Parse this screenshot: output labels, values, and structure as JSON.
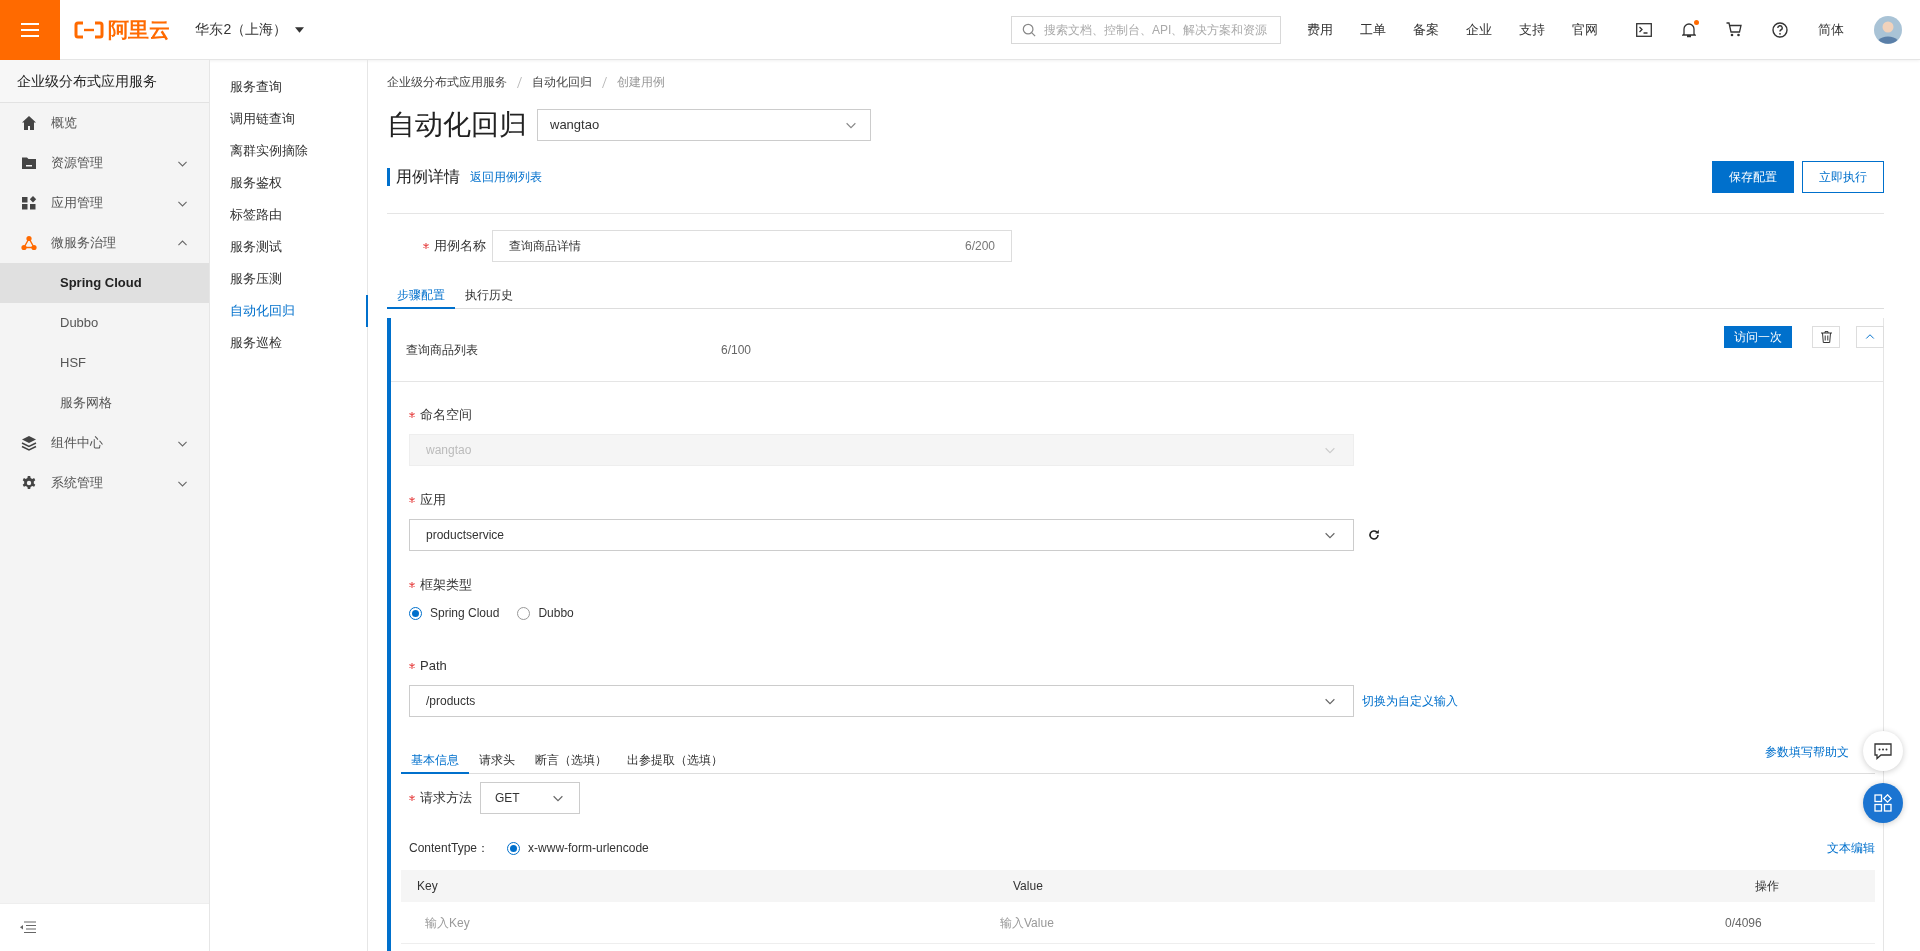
{
  "topbar": {
    "logo": "阿里云",
    "region": "华东2（上海）",
    "search_placeholder": "搜索文档、控制台、API、解决方案和资源",
    "links": [
      "费用",
      "工单",
      "备案",
      "企业",
      "支持",
      "官网"
    ],
    "notification_dot": true,
    "language": "简体"
  },
  "sidebar": {
    "title": "企业级分布式应用服务",
    "items": [
      {
        "label": "概览"
      },
      {
        "label": "资源管理",
        "expanded": false
      },
      {
        "label": "应用管理",
        "expanded": false
      },
      {
        "label": "微服务治理",
        "expanded": true,
        "children": [
          {
            "label": "Spring Cloud",
            "selected": true
          },
          {
            "label": "Dubbo",
            "selected": false
          },
          {
            "label": "HSF",
            "selected": false
          },
          {
            "label": "服务网格",
            "selected": false
          }
        ]
      },
      {
        "label": "组件中心",
        "expanded": false
      },
      {
        "label": "系统管理",
        "expanded": false
      }
    ]
  },
  "subnav": [
    {
      "label": "服务查询",
      "selected": false
    },
    {
      "label": "调用链查询",
      "selected": false
    },
    {
      "label": "离群实例摘除",
      "selected": false
    },
    {
      "label": "服务鉴权",
      "selected": false
    },
    {
      "label": "标签路由",
      "selected": false
    },
    {
      "label": "服务测试",
      "selected": false
    },
    {
      "label": "服务压测",
      "selected": false
    },
    {
      "label": "自动化回归",
      "selected": true
    },
    {
      "label": "服务巡检",
      "selected": false
    }
  ],
  "breadcrumb": [
    "企业级分布式应用服务",
    "自动化回归",
    "创建用例"
  ],
  "page": {
    "title": "自动化回归",
    "namespace": "wangtao"
  },
  "section": {
    "title": "用例详情",
    "back_link": "返回用例列表",
    "buttons": [
      {
        "label": "保存配置",
        "kind": "primary"
      },
      {
        "label": "立即执行",
        "kind": "secondary"
      }
    ]
  },
  "case_name": {
    "label": "用例名称",
    "required": true,
    "value": "查询商品详情",
    "counter": "6/200"
  },
  "tabs": [
    {
      "label": "步骤配置",
      "selected": true
    },
    {
      "label": "执行历史",
      "selected": false
    }
  ],
  "step": {
    "name": "查询商品列表",
    "counter": "6/100",
    "visit_button": "访问一次",
    "expanded": true,
    "fields": [
      {
        "kind": "select",
        "label": "命名空间",
        "required": true,
        "value": "wangtao",
        "disabled": true
      },
      {
        "kind": "select",
        "label": "应用",
        "required": true,
        "value": "productservice",
        "disabled": false,
        "refresh": true
      },
      {
        "kind": "radio",
        "label": "框架类型",
        "required": true,
        "options": [
          {
            "label": "Spring Cloud",
            "selected": true
          },
          {
            "label": "Dubbo",
            "selected": false
          }
        ]
      },
      {
        "kind": "select",
        "label": "Path",
        "required": true,
        "value": "/products",
        "disabled": false,
        "link": "切换为自定义输入"
      }
    ],
    "inner_tabs": [
      {
        "label": "基本信息",
        "selected": true
      },
      {
        "label": "请求头",
        "selected": false
      },
      {
        "label": "断言（选填）",
        "selected": false
      },
      {
        "label": "出参提取（选填）",
        "selected": false
      }
    ],
    "help_link": "参数填写帮助文",
    "request_method": {
      "label": "请求方法",
      "required": true,
      "value": "GET"
    },
    "content_type": {
      "label": "ContentType：",
      "options": [
        {
          "label": "x-www-form-urlencode",
          "selected": true
        }
      ],
      "edit_link": "文本编辑"
    },
    "params": {
      "columns": [
        "Key",
        "Value",
        "操作"
      ],
      "key_placeholder": "输入Key",
      "value_placeholder": "输入Value",
      "counter": "0/4096"
    }
  }
}
